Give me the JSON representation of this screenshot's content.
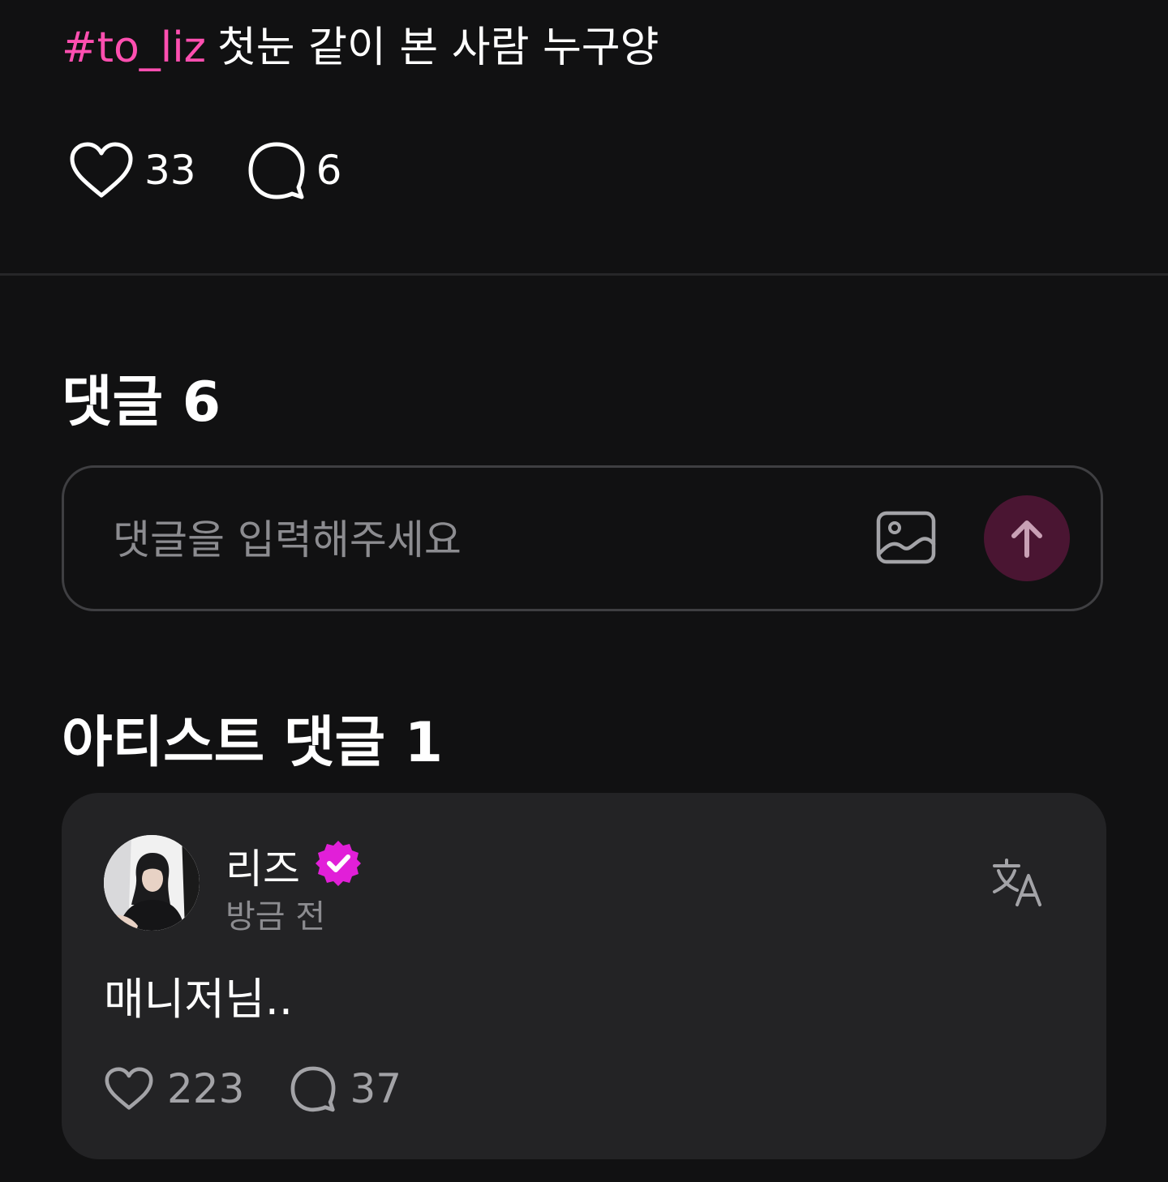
{
  "post": {
    "hashtag": "#to_liz",
    "text": "첫눈 같이 본 사람 누구양",
    "like_count": "33",
    "comment_count": "6"
  },
  "comments": {
    "title": "댓글 6",
    "input_placeholder": "댓글을 입력해주세요"
  },
  "artist_comments": {
    "title": "아티스트 댓글 1",
    "items": [
      {
        "author": "리즈",
        "verified": true,
        "time": "방금 전",
        "body": "매니저님..",
        "like_count": "223",
        "reply_count": "37"
      }
    ]
  },
  "colors": {
    "background": "#111112",
    "hashtag": "#ff4fb0",
    "card": "#232325",
    "send_button": "#4a1532",
    "verified_badge": "#e11fd8"
  },
  "icons": [
    "heart-icon",
    "comment-icon",
    "image-icon",
    "send-arrow-icon",
    "verified-icon",
    "translate-icon"
  ]
}
